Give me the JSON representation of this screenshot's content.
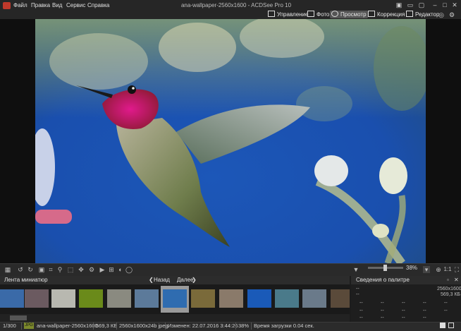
{
  "window": {
    "title": "ana-wallpaper-2560x1600 - ACDSee Pro 10",
    "controls": [
      "minimize",
      "maximize",
      "close"
    ]
  },
  "menu": [
    "Файл",
    "Правка",
    "Вид",
    "Сервис",
    "Справка"
  ],
  "modes": [
    "Управление",
    "Фото",
    "Просмотр",
    "Коррекция",
    "Редактор"
  ],
  "active_mode": "Просмотр",
  "toolbar": {
    "zoom_level": "38%",
    "ratio_label": "1:1"
  },
  "filmstrip": {
    "title": "Лента миниатюр",
    "back_label": "Назад",
    "next_label": "Далее",
    "selected_index": 6,
    "thumb_count": 13
  },
  "info_palette": {
    "title": "Сведения о палитре",
    "dimensions": "2560x1600",
    "size": "569,3 КБ",
    "placeholder": "--"
  },
  "status": {
    "position": "1/300",
    "format_badge": "JPG",
    "filename": "ana-wallpaper-2560x1600",
    "filesize": "569,3 КБ",
    "image_info": "2560x1600x24b jpeg",
    "modified": "Изменен: 22.07.2016 3:44:26",
    "zoom": "38%",
    "load_time": "Время загрузки 0.04 сек."
  },
  "colors": {
    "accent_badge": "#7d8a2c",
    "selected_thumb": "#9a9a9a"
  }
}
